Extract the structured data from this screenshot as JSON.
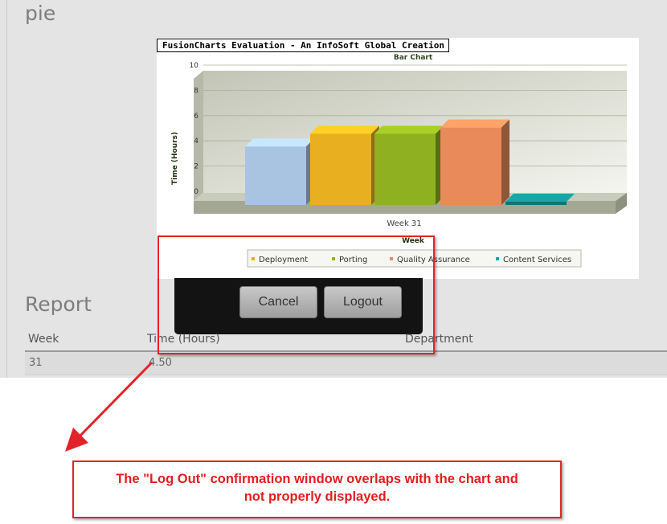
{
  "pie_heading": "pie",
  "chart_data": {
    "type": "bar",
    "watermark": "FusionCharts Evaluation - An InfoSoft Global Creation",
    "title": "Bar Chart",
    "xlabel": "Week",
    "ylabel": "Time (Hours)",
    "ylim": [
      0,
      10
    ],
    "yticks": [
      "0",
      "2",
      "4",
      "6",
      "8",
      "10"
    ],
    "categories": [
      "Week 31"
    ],
    "series": [
      {
        "name": "",
        "values": [
          4
        ],
        "color": "#a9c4e0"
      },
      {
        "name": "Deployment",
        "values": [
          5
        ],
        "color": "#e8b020"
      },
      {
        "name": "Porting",
        "values": [
          5
        ],
        "color": "#8fb020"
      },
      {
        "name": "Quality Assurance",
        "values": [
          5.5
        ],
        "color": "#e88a5a"
      },
      {
        "name": "Content Services",
        "values": [
          0
        ],
        "color": "#1aa5a8"
      }
    ],
    "grid": true,
    "legend_position": "bottom"
  },
  "report": {
    "heading": "Report",
    "columns": [
      "Week",
      "Time (Hours)",
      "Department"
    ],
    "rows": [
      [
        "31",
        "4.50",
        ""
      ]
    ]
  },
  "dialog": {
    "cancel_label": "Cancel",
    "logout_label": "Logout"
  },
  "annotation": {
    "line1": "The \"Log Out\" confirmation window overlaps with the chart and",
    "line2": "not properly displayed.",
    "color": "#e0242a"
  }
}
